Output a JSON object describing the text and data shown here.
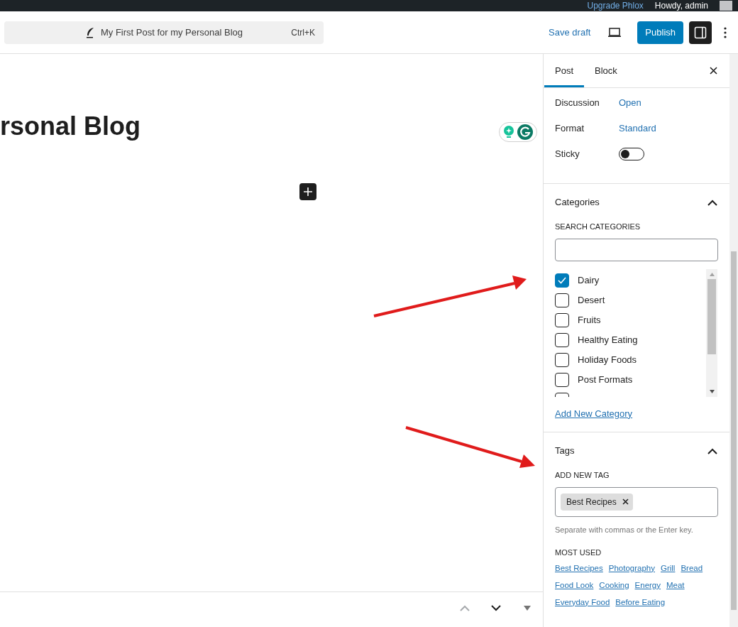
{
  "admin_bar": {
    "upgrade_link": "Upgrade Phlox",
    "greeting": "Howdy, admin"
  },
  "header": {
    "command_bar": {
      "title": "My First Post for my Personal Blog",
      "shortcut": "Ctrl+K"
    },
    "save_draft": "Save draft",
    "publish": "Publish",
    "settings_toggle": {
      "on": true
    }
  },
  "editor": {
    "title": "rsonal Blog",
    "bottom_nav": [
      {
        "kind": "up",
        "disabled": true
      },
      {
        "kind": "down",
        "disabled": false
      },
      {
        "kind": "menu",
        "disabled": false
      }
    ]
  },
  "sidebar": {
    "tabs": [
      {
        "label": "Post",
        "selected": true
      },
      {
        "label": "Block",
        "selected": false
      }
    ],
    "settings": [
      {
        "kind": "link",
        "label": "Discussion",
        "value": "Open"
      },
      {
        "kind": "link",
        "label": "Format",
        "value": "Standard"
      },
      {
        "kind": "toggle",
        "label": "Sticky",
        "on": false
      }
    ],
    "categories": {
      "title": "Categories",
      "expanded": true,
      "search_label": "SEARCH CATEGORIES",
      "items": [
        {
          "label": "Dairy",
          "checked": true
        },
        {
          "label": "Desert",
          "checked": false
        },
        {
          "label": "Fruits",
          "checked": false
        },
        {
          "label": "Healthy Eating",
          "checked": false
        },
        {
          "label": "Holiday Foods",
          "checked": false
        },
        {
          "label": "Post Formats",
          "checked": false
        },
        {
          "checked": false
        }
      ],
      "add_link": "Add New Category"
    },
    "tags": {
      "title": "Tags",
      "expanded": true,
      "input_label": "ADD NEW TAG",
      "tokens": [
        "Best Recipes"
      ],
      "hint": "Separate with commas or the Enter key.",
      "most_used_label": "MOST USED",
      "most_used": [
        [
          "Best Recipes",
          "Photography",
          "Grill",
          "Bread"
        ],
        [
          "Food Look",
          "Cooking",
          "Energy",
          "Meat"
        ],
        [
          "Everyday Food",
          "Before Eating"
        ]
      ]
    }
  }
}
